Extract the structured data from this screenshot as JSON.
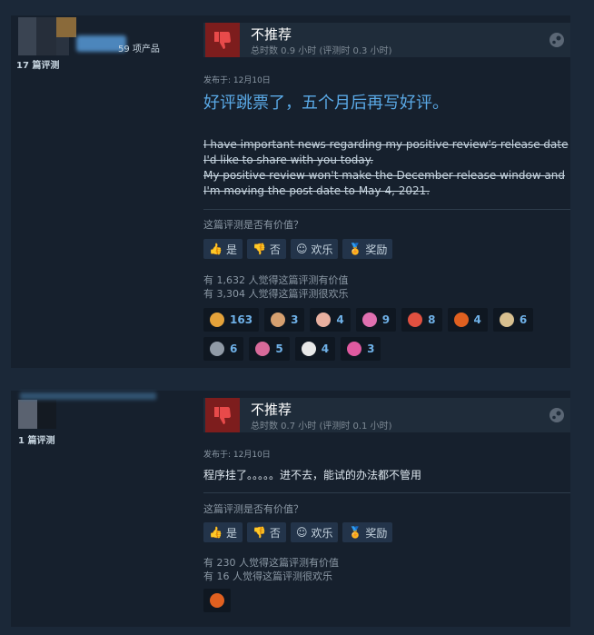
{
  "reviews": [
    {
      "author": {
        "products_text": "59 项产品",
        "reviews_text": "17 篇评测"
      },
      "verdict": "不推荐",
      "hours": "总时数 0.9 小时   (评测时 0.3 小时)",
      "posted": "发布于: 12月10日",
      "headline": "好评跳票了，五个月后再写好评。",
      "strike_line1": "I have important news regarding my positive review's release date I'd like to share with you today.",
      "strike_line2": "My positive review won't make the December release window and I'm moving the post date to May 4, 2021.",
      "helpful_q": "这篇评测是否有价值？",
      "buttons": {
        "yes": "是",
        "no": "否",
        "funny": "欢乐",
        "award": "奖励"
      },
      "stat_helpful": "有 1,632 人觉得这篇评测有价值",
      "stat_funny": "有 3,304 人觉得这篇评测很欢乐",
      "awards": [
        {
          "icon": "wow-icon",
          "count": "163",
          "color": "#e4a23a"
        },
        {
          "icon": "hand-icon",
          "count": "3",
          "color": "#d6a070"
        },
        {
          "icon": "brain-icon",
          "count": "4",
          "color": "#e8b0a0"
        },
        {
          "icon": "heart-icon",
          "count": "9",
          "color": "#e070b0"
        },
        {
          "icon": "clown-icon",
          "count": "8",
          "color": "#e05040"
        },
        {
          "icon": "fire-icon",
          "count": "4",
          "color": "#e06020"
        },
        {
          "icon": "scroll-icon",
          "count": "6",
          "color": "#d8c090"
        },
        {
          "icon": "face-icon",
          "count": "6",
          "color": "#909aa6"
        },
        {
          "icon": "pig-icon",
          "count": "5",
          "color": "#d86a9a"
        },
        {
          "icon": "statue-icon",
          "count": "4",
          "color": "#e8e8e8"
        },
        {
          "icon": "candy-icon",
          "count": "3",
          "color": "#e05aa0"
        }
      ]
    },
    {
      "author": {
        "reviews_text": "1 篇评测"
      },
      "verdict": "不推荐",
      "hours": "总时数 0.7 小时   (评测时 0.1 小时)",
      "posted": "发布于: 12月10日",
      "body": "程序挂了。。。。。进不去，能试的办法都不管用",
      "helpful_q": "这篇评测是否有价值？",
      "buttons": {
        "yes": "是",
        "no": "否",
        "funny": "欢乐",
        "award": "奖励"
      },
      "stat_helpful": "有 230 人觉得这篇评测有价值",
      "stat_funny": "有 16 人觉得这篇评测很欢乐",
      "awards": [
        {
          "icon": "fire-icon",
          "count": "",
          "color": "#e06020"
        }
      ]
    }
  ]
}
